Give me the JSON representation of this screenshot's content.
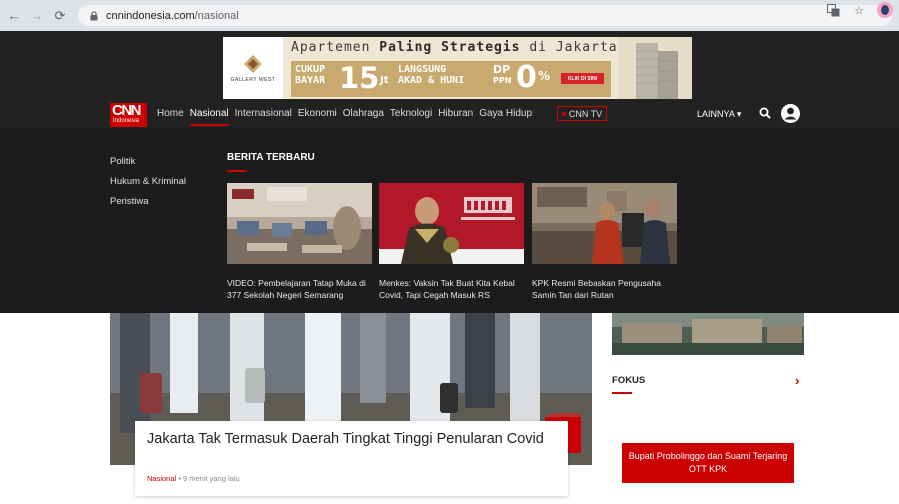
{
  "browser": {
    "url_host": "cnnindonesia.com",
    "url_path": "/nasional"
  },
  "ad": {
    "logo_name": "GALLERY WEST",
    "headline_pre": "Apartemen ",
    "headline_bold": "Paling Strategis",
    "headline_post": " di Jakarta Barat",
    "cukup": "CUKUP",
    "bayar": "BAYAR",
    "amount": "15",
    "unit": "Jt",
    "langsung": "LANGSUNG",
    "akad": "AKAD & HUNI",
    "dp": "DP",
    "ppn": "PPN",
    "zero": "0",
    "pct": "%",
    "cta": "KLIK DI SINI"
  },
  "nav": {
    "logo_top": "CNN",
    "logo_bottom": "Indonesia",
    "links": [
      "Home",
      "Nasional",
      "Internasional",
      "Ekonomi",
      "Olahraga",
      "Teknologi",
      "Hiburan",
      "Gaya Hidup"
    ],
    "cnn_tv": "CNN TV",
    "lainnya": "LAINNYA ▾"
  },
  "megamenu": {
    "sub_links": [
      "Politik",
      "Hukum & Kriminal",
      "Peristiwa"
    ],
    "section_title": "BERITA TERBARU",
    "cards": [
      {
        "caption": "VIDEO: Pembelajaran Tatap Muka di 377 Sekolah Negeri Semarang"
      },
      {
        "caption": "Menkes: Vaksin Tak Buat Kita Kebal Covid, Tapi Cegah Masuk RS"
      },
      {
        "caption": "KPK Resmi Bebaskan Pengusaha Samin Tan dari Rutan"
      }
    ]
  },
  "article": {
    "headline": "Jakarta Tak Termasuk Daerah Tingkat Tinggi Penularan Covid",
    "category": "Nasional",
    "time": " • 9 menit yang lalu"
  },
  "sidebar": {
    "fokus": "FOKUS",
    "promo": "Bupati Probolinggo dan Suami Terjaring OTT KPK"
  },
  "colors": {
    "brand_red": "#cc0000",
    "nav_bg": "#222222",
    "menu_bg": "#1c1c1c"
  }
}
